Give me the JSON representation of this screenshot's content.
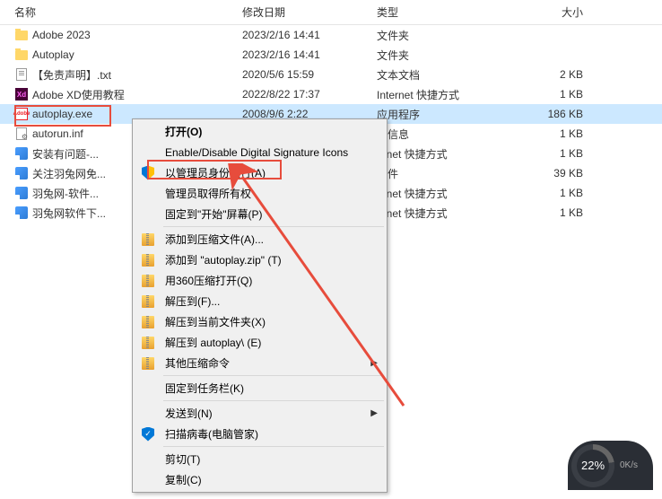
{
  "columns": {
    "name": "名称",
    "date": "修改日期",
    "type": "类型",
    "size": "大小"
  },
  "rows": [
    {
      "icon": "folder",
      "name": "Adobe 2023",
      "date": "2023/2/16 14:41",
      "type": "文件夹",
      "size": ""
    },
    {
      "icon": "folder",
      "name": "Autoplay",
      "date": "2023/2/16 14:41",
      "type": "文件夹",
      "size": ""
    },
    {
      "icon": "txt",
      "name": "【免责声明】.txt",
      "date": "2020/5/6 15:59",
      "type": "文本文档",
      "size": "2 KB"
    },
    {
      "icon": "xd",
      "name": "Adobe XD使用教程",
      "date": "2022/8/22 17:37",
      "type": "Internet 快捷方式",
      "size": "1 KB"
    },
    {
      "icon": "adobe",
      "name": "autoplay.exe",
      "date": "2008/9/6 2:22",
      "type": "应用程序",
      "size": "186 KB",
      "selected": true
    },
    {
      "icon": "inf",
      "name": "autorun.inf",
      "date": "",
      "type": "装信息",
      "size": "1 KB"
    },
    {
      "icon": "shortcut",
      "name": "安装有问题-...",
      "date": "",
      "type": "ernet 快捷方式",
      "size": "1 KB"
    },
    {
      "icon": "shortcut",
      "name": "关注羽兔网免...",
      "date": "",
      "type": "文件",
      "size": "39 KB"
    },
    {
      "icon": "shortcut",
      "name": "羽兔网-软件...",
      "date": "",
      "type": "ernet 快捷方式",
      "size": "1 KB"
    },
    {
      "icon": "shortcut",
      "name": "羽兔网软件下...",
      "date": "",
      "type": "ernet 快捷方式",
      "size": "1 KB"
    }
  ],
  "menu": {
    "open": "打开(O)",
    "digital_sig": "Enable/Disable Digital Signature Icons",
    "run_as_admin": "以管理员身份运行(A)",
    "take_ownership": "管理员取得所有权",
    "pin_start": "固定到\"开始\"屏幕(P)",
    "add_archive": "添加到压缩文件(A)...",
    "add_autoplay_zip": "添加到 \"autoplay.zip\" (T)",
    "open_360": "用360压缩打开(Q)",
    "extract_to": "解压到(F)...",
    "extract_current": "解压到当前文件夹(X)",
    "extract_autoplay": "解压到 autoplay\\ (E)",
    "other_archive": "其他压缩命令",
    "pin_taskbar": "固定到任务栏(K)",
    "send_to": "发送到(N)",
    "scan_virus": "扫描病毒(电脑管家)",
    "cut": "剪切(T)",
    "copy": "复制(C)"
  },
  "speed": {
    "percent": "22%",
    "rate": "0K/s"
  }
}
